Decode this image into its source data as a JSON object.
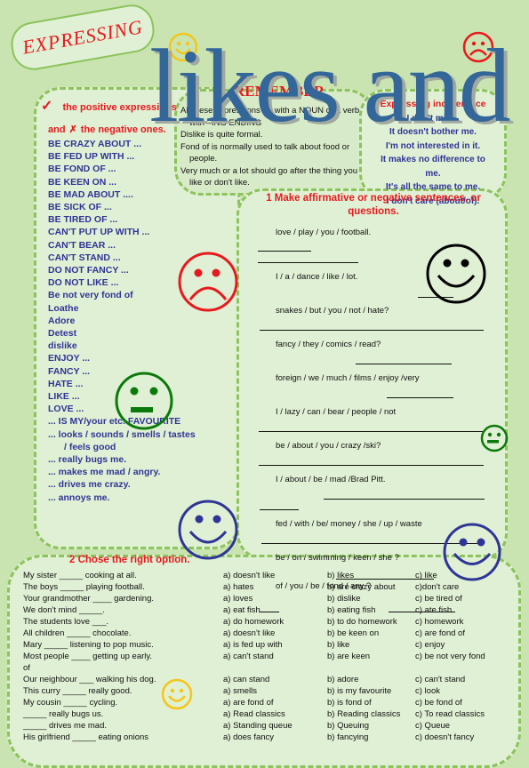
{
  "header": {
    "title_pill": "EXPRESSING",
    "big_title": "likes and"
  },
  "left_panel": {
    "positive_heading": "the positive expressions",
    "negative_heading_prefix": "and",
    "negative_heading": "the negative ones.",
    "check_icon": "✓",
    "cross_icon": "✗",
    "expressions": [
      "BE CRAZY ABOUT ...",
      "BE FED UP WITH ...",
      "BE FOND OF ...",
      "BE KEEN ON ...",
      "BE MAD ABOUT ....",
      "BE SICK OF ...",
      "BE TIRED OF ...",
      "CAN'T PUT UP WITH ...",
      "CAN'T BEAR ...",
      "CAN'T STAND ...",
      "DO NOT FANCY ...",
      "DO NOT LIKE ...",
      "Be not very fond of",
      "Loathe",
      "Adore",
      "Detest",
      "dislike",
      "ENJOY ...",
      "FANCY ...",
      "HATE ...",
      "LIKE ...",
      "LOVE ...",
      "... IS MY/your etc. FAVOURITE",
      "... looks / sounds / smells /  tastes",
      "    / feels good",
      "... really bugs me.",
      "... makes me mad / angry.",
      "... drives me crazy.",
      "... annoys me."
    ]
  },
  "remember": {
    "heading": "REMEMBER",
    "lines": [
      "All these expressions go with a NOUN or a verb",
      "with –ING ENDING",
      "Dislike is quite formal.",
      "Fond of is normally used to talk about food or",
      "people.",
      "Very much or a lot should go after the thing you",
      "like or don't like."
    ]
  },
  "indifference": {
    "heading": "Expressing indifference",
    "lines": [
      "I don't mind.",
      "It doesn't bother me.",
      "I'm not interested in it.",
      "It makes no difference to",
      "me.",
      "It's all the same to me.",
      "I don't care (about/of)."
    ]
  },
  "exercise1": {
    "heading": "1 Make affirmative or negative sentences, or questions.",
    "items": [
      "love / play / you / football.",
      "I / a / dance / like / lot.",
      "snakes / but / you / not / hate?",
      "fancy / they / comics / read?",
      "foreign / we / much / films / enjoy /very",
      "I / lazy / can / bear / people / not",
      "be / about / you / crazy /ski?",
      "I / about / be / mad /Brad Pitt.",
      "fed / with / be/  money / she / up / waste",
      "be / on / swimming / keen  / she ?",
      "of / you / be / fond / any ?"
    ]
  },
  "exercise2": {
    "heading": "2 Chose the right option.",
    "rows": [
      {
        "q": "My sister _____ cooking at all.",
        "a": "a) doesn't like",
        "b": "b) likes",
        "c": "c) like"
      },
      {
        "q": "The boys _____ playing football.",
        "a": "a) hates",
        "b": "b) are crazy about",
        "c": "c)don't care"
      },
      {
        "q": "Your grandmother ____ gardening.",
        "a": "a) loves",
        "b": "b) dislike",
        "c": "c) be tired of"
      },
      {
        "q": "We don't mind _____.",
        "a": "a) eat fish",
        "b": "b) eating fish",
        "c": "c) ate fish"
      },
      {
        "q": "The students love ___.",
        "a": "a) do homework",
        "b": "b) to do homework",
        "c": "c) homework"
      },
      {
        "q": "All children _____ chocolate.",
        "a": "a) doesn't like",
        "b": "b) be keen on",
        "c": "c) are fond of"
      },
      {
        "q": "Mary _____ listening to pop music.",
        "a": "a) is fed up with",
        "b": "b) like",
        "c": "c) enjoy"
      },
      {
        "q": "Most people ____ getting up early.",
        "a": "a) can't stand",
        "b": "b) are keen",
        "c": "c) be not very fond"
      },
      {
        "q": "        of",
        "a": "",
        "b": "",
        "c": ""
      },
      {
        "q": "Our neighbour ___ walking his dog.",
        "a": "a) can stand",
        "b": "b) adore",
        "c": "c) can't stand"
      },
      {
        "q": "This curry _____ really good.",
        "a": "a) smells",
        "b": "b) is my favourite",
        "c": "c) look"
      },
      {
        "q": "My cousin _____ cycling.",
        "a": "a) are fond of",
        "b": "b) is fond of",
        "c": "c) be fond of"
      },
      {
        "q": "_____ really bugs us.",
        "a": "a) Read classics",
        "b": "b) Reading classics",
        "c": "c) To read classics"
      },
      {
        "q": "_____ drives me mad.",
        "a": "a) Standing queue",
        "b": "b) Queuing",
        "c": "c) Queue"
      },
      {
        "q": "His girlfriend _____ eating onions",
        "a": "a) does fancy",
        "b": "b) fancying",
        "c": "c) doesn't fancy"
      }
    ]
  },
  "colors": {
    "background": "#c9e4b0",
    "panel": "#e0f0d4",
    "dash": "#8cc35c",
    "red": "#e8191e",
    "blue_text": "#2f3596",
    "title_blue": "#336699"
  }
}
